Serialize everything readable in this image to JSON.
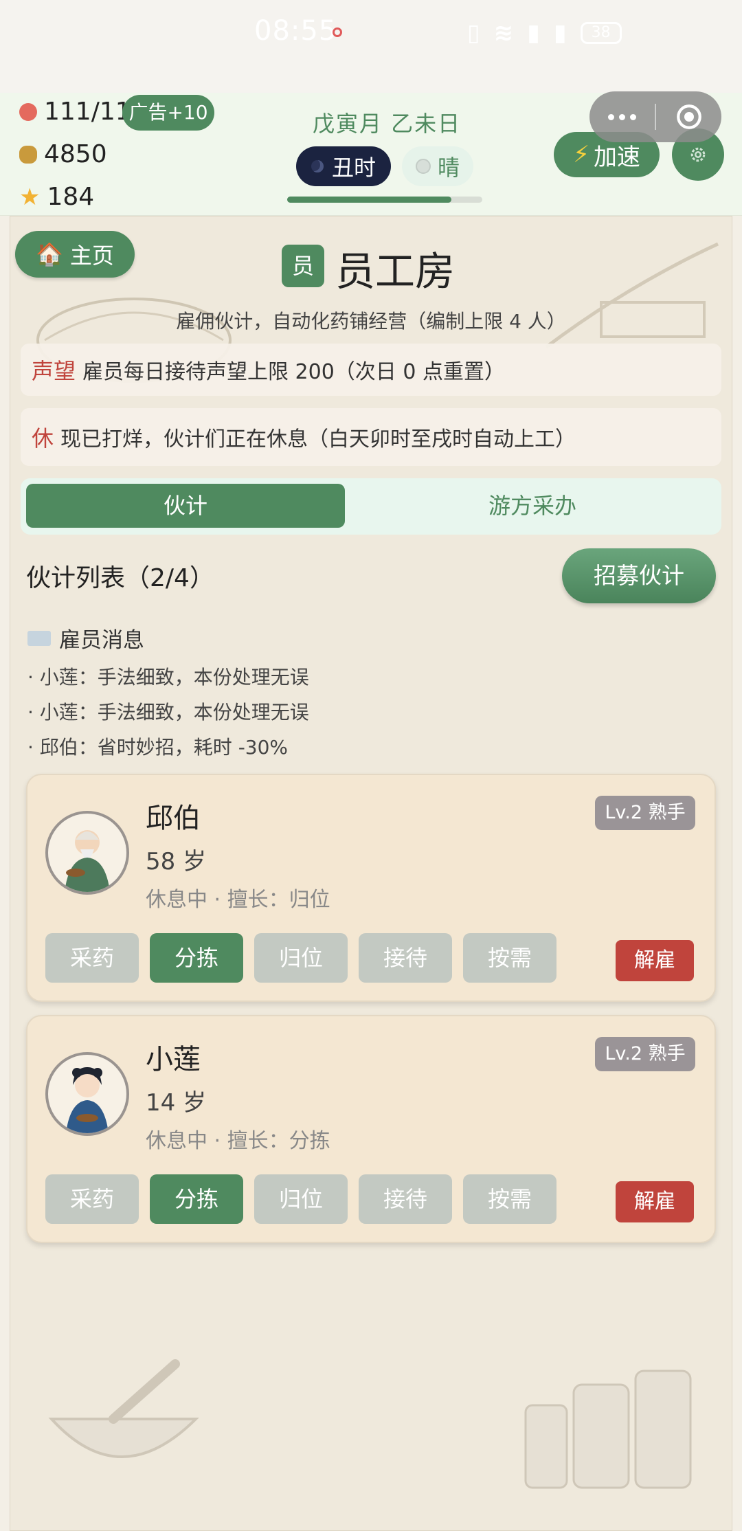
{
  "status_bar": {
    "time": "08:55",
    "battery": "38"
  },
  "resources": {
    "stamina": "111/115",
    "ad_bonus": "广告+10",
    "coins": "4850",
    "stars": "184"
  },
  "calendar": {
    "date": "戊寅月 乙未日",
    "shichen": "丑时",
    "weather": "晴",
    "day_progress": 0.84
  },
  "speed_button": "加速",
  "home_button": "主页",
  "page": {
    "title_badge": "员",
    "title": "员工房",
    "subtitle": "雇佣伙计，自动化药铺经营（编制上限 4 人）"
  },
  "notices": [
    {
      "tag": "声望",
      "text": "雇员每日接待声望上限 200（次日 0 点重置）"
    },
    {
      "tag": "休",
      "text": "现已打烊，伙计们正在休息（白天卯时至戌时自动上工）"
    }
  ],
  "tabs": [
    "伙计",
    "游方采办"
  ],
  "list": {
    "title": "伙计列表（2/4）",
    "recruit_button": "招募伙计"
  },
  "messages": {
    "title": "雇员消息",
    "items": [
      "· 小莲：手法细致，本份处理无误",
      "· 小莲：手法细致，本份处理无误",
      "· 邱伯：省时妙招，耗时 -30%"
    ]
  },
  "workers": [
    {
      "name": "邱伯",
      "age": "58 岁",
      "status": "休息中 · 擅长：归位",
      "level": "Lv.2 熟手",
      "actions": [
        "采药",
        "分拣",
        "归位",
        "接待",
        "按需"
      ],
      "active_action": "分拣",
      "fire": "解雇"
    },
    {
      "name": "小莲",
      "age": "14 岁",
      "status": "休息中 · 擅长：分拣",
      "level": "Lv.2 熟手",
      "actions": [
        "采药",
        "分拣",
        "归位",
        "接待",
        "按需"
      ],
      "active_action": "分拣",
      "fire": "解雇"
    }
  ],
  "colors": {
    "primary": "#4f8a5f",
    "danger": "#c0443c",
    "night": "#1b2340",
    "card": "#f4e7d2"
  }
}
